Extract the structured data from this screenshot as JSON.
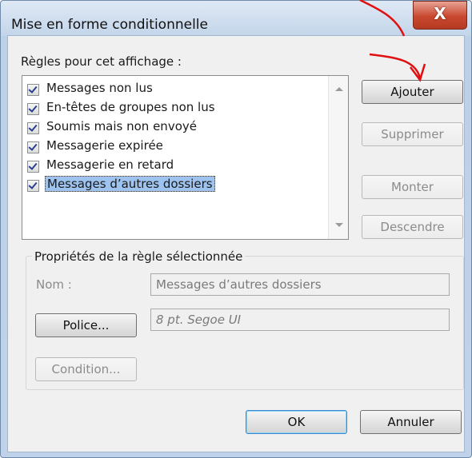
{
  "window": {
    "title": "Mise en forme conditionnelle",
    "close_glyph": "X"
  },
  "rules": {
    "label": "Règles pour cet affichage :",
    "items": [
      {
        "label": "Messages non lus",
        "checked": true
      },
      {
        "label": "En-têtes de groupes non lus",
        "checked": true
      },
      {
        "label": "Soumis mais non envoyé",
        "checked": true
      },
      {
        "label": "Messagerie expirée",
        "checked": true
      },
      {
        "label": "Messagerie en retard",
        "checked": true
      },
      {
        "label": "Messages d’autres dossiers",
        "checked": true,
        "selected": true
      }
    ]
  },
  "buttons": {
    "add": "Ajouter",
    "delete": "Supprimer",
    "up": "Monter",
    "down": "Descendre",
    "font": "Police...",
    "condition": "Condition...",
    "ok": "OK",
    "cancel": "Annuler"
  },
  "properties": {
    "title": "Propriétés de la règle sélectionnée",
    "name_label": "Nom :",
    "name_value": "Messages d’autres dossiers",
    "font_value": "8 pt. Segoe UI"
  },
  "colors": {
    "selection": "#9ec3ee",
    "annotation_arrow": "#e01010",
    "close_button": "#c9482f"
  }
}
